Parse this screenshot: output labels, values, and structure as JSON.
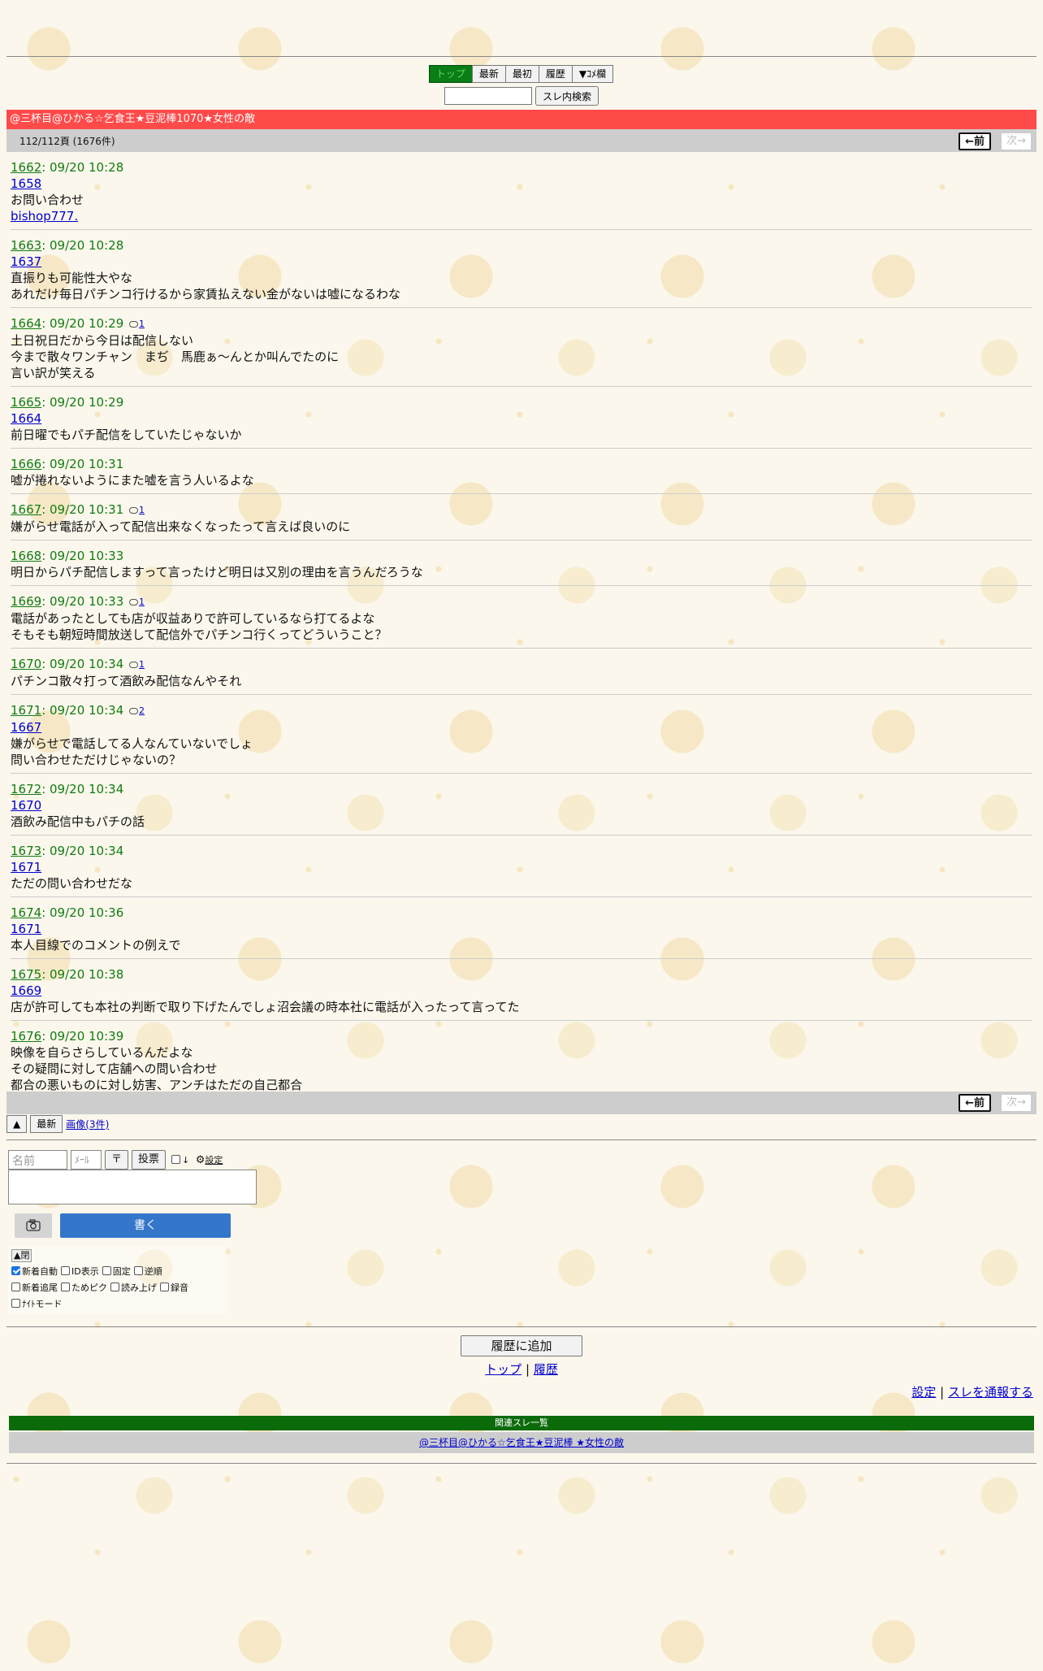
{
  "nav": {
    "top": "トップ",
    "latest": "最新",
    "first": "最初",
    "history": "履歴",
    "comment": "▼ｺﾒ欄"
  },
  "search": {
    "placeholder": "",
    "button": "スレ内検索"
  },
  "thread": {
    "title": "@三杯目@ひかる☆乞食王★豆泥棒1070★女性の敵",
    "page_info": "112/112頁 (1676件)",
    "prev": "←前",
    "next": "次→"
  },
  "posts": [
    {
      "num": "1662",
      "time": ": 09/20 10:28",
      "replies": "",
      "ref": "1658",
      "lines": [
        "お問い合わせ"
      ],
      "link": "bishop777."
    },
    {
      "num": "1663",
      "time": ": 09/20 10:28",
      "replies": "",
      "ref": "1637",
      "lines": [
        "直振りも可能性大やな",
        "あれだけ毎日パチンコ行けるから家賃払えない金がないは嘘になるわな"
      ],
      "link": ""
    },
    {
      "num": "1664",
      "time": ": 09/20 10:29",
      "replies": "1",
      "ref": "",
      "lines": [
        "土日祝日だから今日は配信しない",
        "今まで散々ワンチャン　まぢ　馬鹿ぁ～んとか叫んでたのに",
        "言い訳が笑える"
      ],
      "link": ""
    },
    {
      "num": "1665",
      "time": ": 09/20 10:29",
      "replies": "",
      "ref": "1664",
      "lines": [
        "前日曜でもパチ配信をしていたじゃないか"
      ],
      "link": ""
    },
    {
      "num": "1666",
      "time": ": 09/20 10:31",
      "replies": "",
      "ref": "",
      "lines": [
        "嘘が捲れないようにまた嘘を言う人いるよな"
      ],
      "link": ""
    },
    {
      "num": "1667",
      "time": ": 09/20 10:31",
      "replies": "1",
      "ref": "",
      "lines": [
        "嫌がらせ電話が入って配信出来なくなったって言えば良いのに"
      ],
      "link": ""
    },
    {
      "num": "1668",
      "time": ": 09/20 10:33",
      "replies": "",
      "ref": "",
      "lines": [
        "明日からパチ配信しますって言ったけど明日は又別の理由を言うんだろうな"
      ],
      "link": ""
    },
    {
      "num": "1669",
      "time": ": 09/20 10:33",
      "replies": "1",
      "ref": "",
      "lines": [
        "電話があったとしても店が収益ありで許可しているなら打てるよな",
        "そもそも朝短時間放送して配信外でパチンコ行くってどういうこと？"
      ],
      "link": ""
    },
    {
      "num": "1670",
      "time": ": 09/20 10:34",
      "replies": "1",
      "ref": "",
      "lines": [
        "パチンコ散々打って酒飲み配信なんやそれ"
      ],
      "link": ""
    },
    {
      "num": "1671",
      "time": ": 09/20 10:34",
      "replies": "2",
      "ref": "1667",
      "lines": [
        "嫌がらせで電話してる人なんていないでしょ",
        "問い合わせただけじゃないの？"
      ],
      "link": ""
    },
    {
      "num": "1672",
      "time": ": 09/20 10:34",
      "replies": "",
      "ref": "1670",
      "lines": [
        "酒飲み配信中もパチの話"
      ],
      "link": ""
    },
    {
      "num": "1673",
      "time": ": 09/20 10:34",
      "replies": "",
      "ref": "1671",
      "lines": [
        "ただの問い合わせだな"
      ],
      "link": ""
    },
    {
      "num": "1674",
      "time": ": 09/20 10:36",
      "replies": "",
      "ref": "1671",
      "lines": [
        "本人目線でのコメントの例えで"
      ],
      "link": ""
    },
    {
      "num": "1675",
      "time": ": 09/20 10:38",
      "replies": "",
      "ref": "1669",
      "lines": [
        "店が許可しても本社の判断で取り下げたんでしょ沼会議の時本社に電話が入ったって言ってた"
      ],
      "link": ""
    },
    {
      "num": "1676",
      "time": ": 09/20 10:39",
      "replies": "",
      "ref": "",
      "lines": [
        "映像を自らさらしているんだよな",
        "その疑問に対して店舗への問い合わせ",
        "都合の悪いものに対し妨害、アンチはただの自己都合"
      ],
      "link": ""
    }
  ],
  "tools": {
    "up": "▲",
    "latest": "最新",
    "images": "画像(3件)"
  },
  "form": {
    "name_placeholder": "名前",
    "mail_placeholder": "ﾒｰﾙ",
    "fix_btn": "〒",
    "vote_btn": "投票",
    "age_label": "↓",
    "settings": "設定",
    "write_btn": "書く",
    "collapse": "▲閉",
    "options": [
      {
        "label": "新着自動",
        "checked": true
      },
      {
        "label": "ID表示",
        "checked": false
      },
      {
        "label": "固定",
        "checked": false
      },
      {
        "label": "逆順",
        "checked": false
      },
      {
        "label": "新着追尾",
        "checked": false
      },
      {
        "label": "ためピク",
        "checked": false
      },
      {
        "label": "読み上げ",
        "checked": false
      },
      {
        "label": "録音",
        "checked": false
      },
      {
        "label": "ﾅｲﾄモード",
        "checked": false
      }
    ]
  },
  "footer": {
    "add_history": "履歴に追加",
    "top": "トップ",
    "sep": "|",
    "history": "履歴",
    "settings": "設定",
    "report": "スレを通報する",
    "related_title": "関連スレ一覧",
    "related_item": "@三杯目@ひかる☆乞食王★豆泥棒 ★女性の敵"
  },
  "colors": {
    "title_bar": "#ff4a4a",
    "active_tab": "#0a7d16",
    "write_button": "#3476c9",
    "related_header": "#0b6b0b"
  }
}
